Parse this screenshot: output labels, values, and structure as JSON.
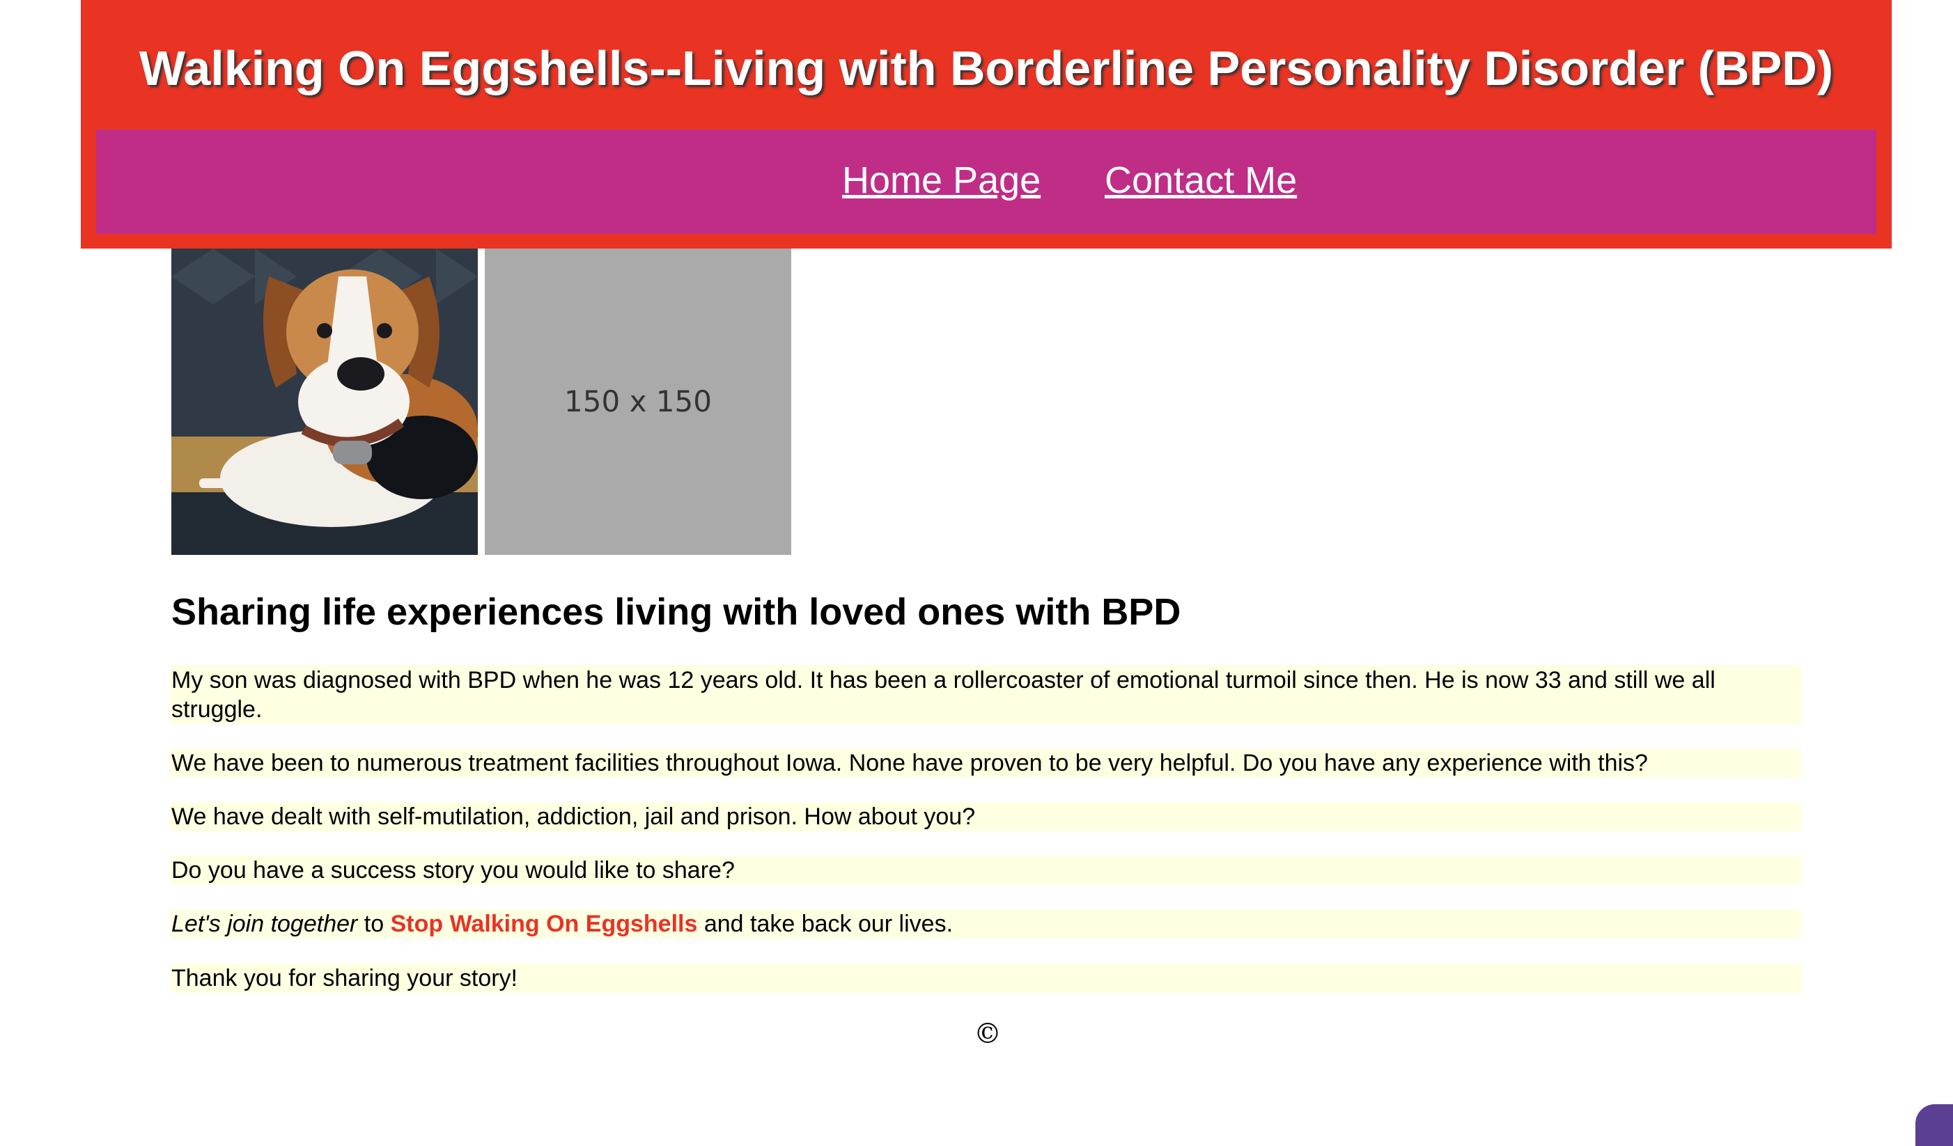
{
  "header": {
    "title": "Walking On Eggshells--Living with Borderline Personality Disorder (BPD)"
  },
  "nav": {
    "home": "Home Page",
    "contact": "Contact Me"
  },
  "images": {
    "placeholder_label": "150 x 150"
  },
  "content": {
    "heading": "Sharing life experiences living with loved ones with BPD",
    "p1": "My son was diagnosed with BPD when he was 12 years old. It has been a rollercoaster of emotional turmoil since then. He is now 33 and still we all struggle.",
    "p2": "We have been to numerous treatment facilities throughout Iowa. None have proven to be very helpful. Do you have any experience with this?",
    "p3": "We have dealt with self-mutilation, addiction, jail and prison. How about you?",
    "p4": "Do you have a success story you would like to share?",
    "p5_italic": "Let's join together",
    "p5_to": " to ",
    "p5_red": "Stop Walking On Eggshells",
    "p5_rest": " and take back our lives.",
    "p6": "Thank you for sharing your story!"
  },
  "footer": {
    "copyright": "©"
  },
  "colors": {
    "header_bg": "#e93323",
    "nav_bg": "#bf2d86",
    "paragraph_bg": "#ffffe2",
    "accent_red": "#e93323"
  }
}
